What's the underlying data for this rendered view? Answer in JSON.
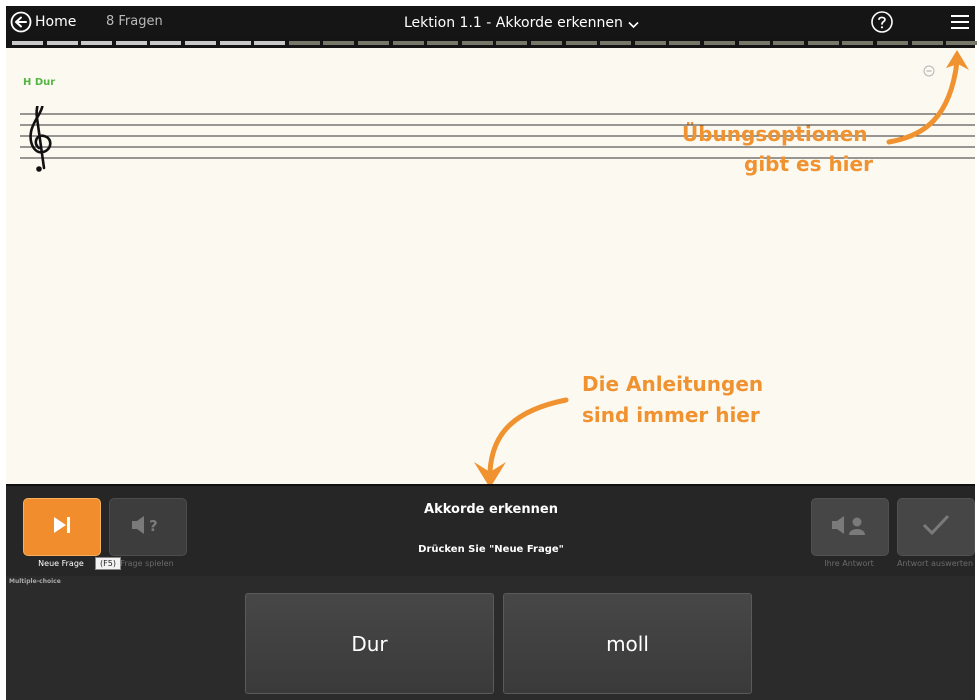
{
  "header": {
    "home_label": "Home",
    "question_count": "8 Fragen",
    "lesson_title": "Lektion 1.1 - Akkorde erkennen",
    "icons": [
      "back-arrow-circle-icon",
      "chevron-down-icon",
      "help-circle-icon",
      "hamburger-menu-icon"
    ]
  },
  "progress": {
    "total_segments": 28,
    "completed_segments": 8,
    "completed_color": "#c9c9c9",
    "remaining_color": "#77776a"
  },
  "staff": {
    "key_label": "H Dur",
    "clef_icon": "treble-clef-icon",
    "zoom_icon": "zoom-out-icon"
  },
  "annotations": {
    "options_line1": "Übungsoptionen",
    "options_line2": "gibt es hier",
    "instructions_line1": "Die Anleitungen",
    "instructions_line2": "sind immer hier",
    "color": "#f0922f"
  },
  "controls": {
    "new_question_label": "Neue Frage",
    "shortcut_tooltip": "(F5)",
    "play_question_label": "Frage spielen",
    "your_answer_label": "Ihre Antwort",
    "evaluate_label": "Antwort auswerten",
    "instruction_title": "Akkorde erkennen",
    "instruction_text": "Drücken Sie \"Neue Frage\"",
    "accent_color": "#f18d2c"
  },
  "answers": {
    "mode_label": "Multiple-choice",
    "options": [
      "Dur",
      "moll"
    ]
  }
}
